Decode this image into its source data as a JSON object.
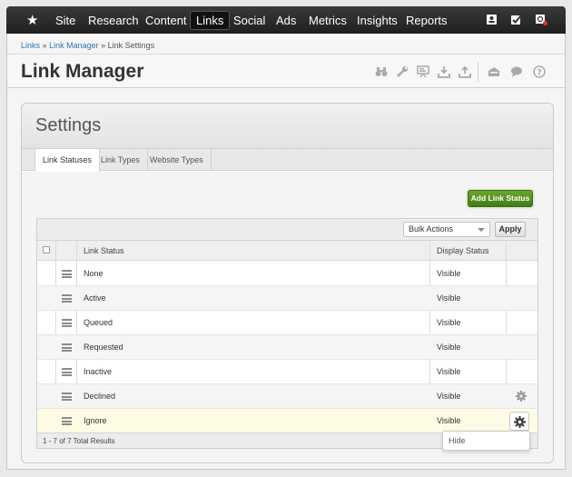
{
  "nav": {
    "items": [
      "Site",
      "Research",
      "Content",
      "Links",
      "Social",
      "Ads",
      "Metrics",
      "Insights",
      "Reports"
    ],
    "active": "Links"
  },
  "breadcrumb": {
    "crumb1": "Links",
    "sep": "»",
    "crumb2": "Link Manager",
    "current": "Link Settings"
  },
  "page_title": "Link Manager",
  "settings": {
    "title": "Settings",
    "tabs": [
      "Link Statuses",
      "Link Types",
      "Website Types"
    ],
    "add_button": "Add Link Status",
    "bulk_actions": "Bulk Actions",
    "apply": "Apply",
    "columns": {
      "status": "Link Status",
      "display": "Display Status"
    },
    "rows": [
      {
        "name": "None",
        "display": "Visible"
      },
      {
        "name": "Active",
        "display": "Visible"
      },
      {
        "name": "Queued",
        "display": "Visible"
      },
      {
        "name": "Requested",
        "display": "Visible"
      },
      {
        "name": "Inactive",
        "display": "Visible"
      },
      {
        "name": "Declined",
        "display": "Visible"
      },
      {
        "name": "Ignore",
        "display": "Visible"
      }
    ],
    "footer": "1 - 7 of 7 Total Results",
    "menu_item": "Hide"
  },
  "colors": {
    "nav_bg": "#2b2b2b",
    "accent_green": "#4f8d1f",
    "link_blue": "#2a78b8",
    "highlight_row": "#fdfbe3"
  }
}
